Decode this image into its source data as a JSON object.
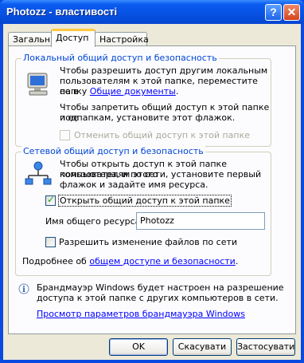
{
  "window": {
    "title": "Photozz - властивості"
  },
  "tabs": [
    {
      "label": "Загальні"
    },
    {
      "label": "Доступ"
    },
    {
      "label": "Настройка"
    }
  ],
  "local": {
    "title": "Локальный общий доступ и безопасность",
    "line1": "Чтобы разрешить доступ другим локальным",
    "line2": "пользователям к этой папке, переместите ее в",
    "line3_prefix": "папку ",
    "line3_link": "Общие документы",
    "line3_suffix": ".",
    "line4": "Чтобы запретить общий доступ к этой папке и ее",
    "line5": "подпапкам, установите этот флажок.",
    "checkbox_label": "Отменить общий доступ к этой папке"
  },
  "network": {
    "title": "Сетевой общий доступ и безопасность",
    "line1": "Чтобы открыть доступ к этой папке пользователям этого",
    "line2": "компьютера, и по сети, установите первый",
    "line3": "флажок и задайте имя ресурса.",
    "share_checkbox_label": "Открыть общий доступ к этой папке",
    "share_checked": true,
    "share_name_label": "Имя общего ресурса:",
    "share_name_value": "Photozz",
    "allow_change_label": "Разрешить изменение файлов по сети",
    "allow_change_checked": false,
    "more_prefix": "Подробнее об ",
    "more_link": "общем доступе и безопасности",
    "more_suffix": "."
  },
  "firewall": {
    "line1": "Брандмауэр Windows будет настроен на разрешение",
    "line2": "доступа к этой папке с других компьютеров в сети.",
    "link": "Просмотр параметров брандмауэра Windows"
  },
  "buttons": {
    "ok": "OK",
    "cancel": "Скасувати",
    "apply": "Застосувати"
  }
}
